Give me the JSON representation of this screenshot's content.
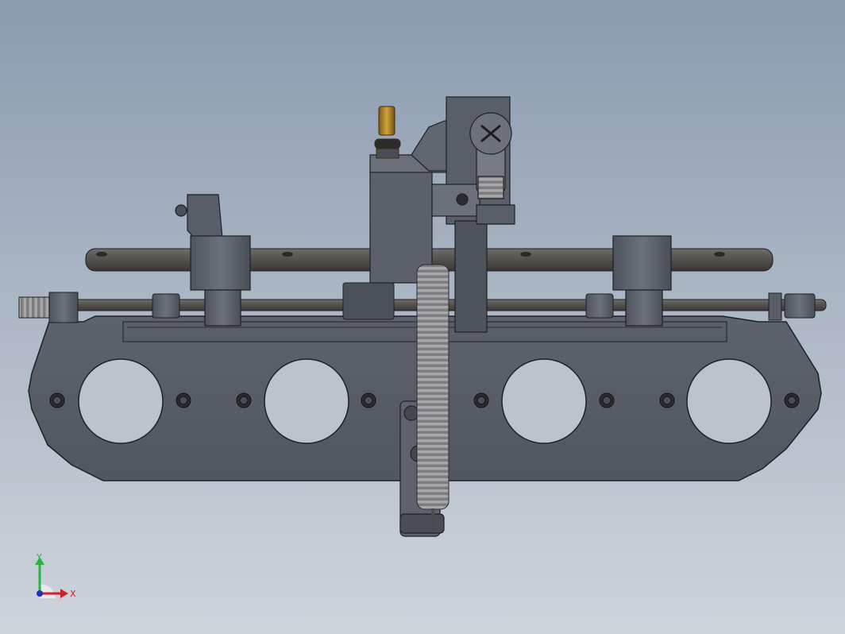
{
  "viewport": {
    "background_top": "#8b9bb1",
    "background_bottom": "#cfd4db"
  },
  "model": {
    "name": "throttle-linkage-intake-manifold",
    "part_color": "#5c606b",
    "edge_color": "#1e2026",
    "brass_color": "#b8892a",
    "spring_color": "#8f8f92"
  },
  "triad": {
    "x_label": "X",
    "y_label": "Y",
    "x_color": "#d0202a",
    "y_color": "#26b640",
    "z_color": "#2030c0"
  }
}
